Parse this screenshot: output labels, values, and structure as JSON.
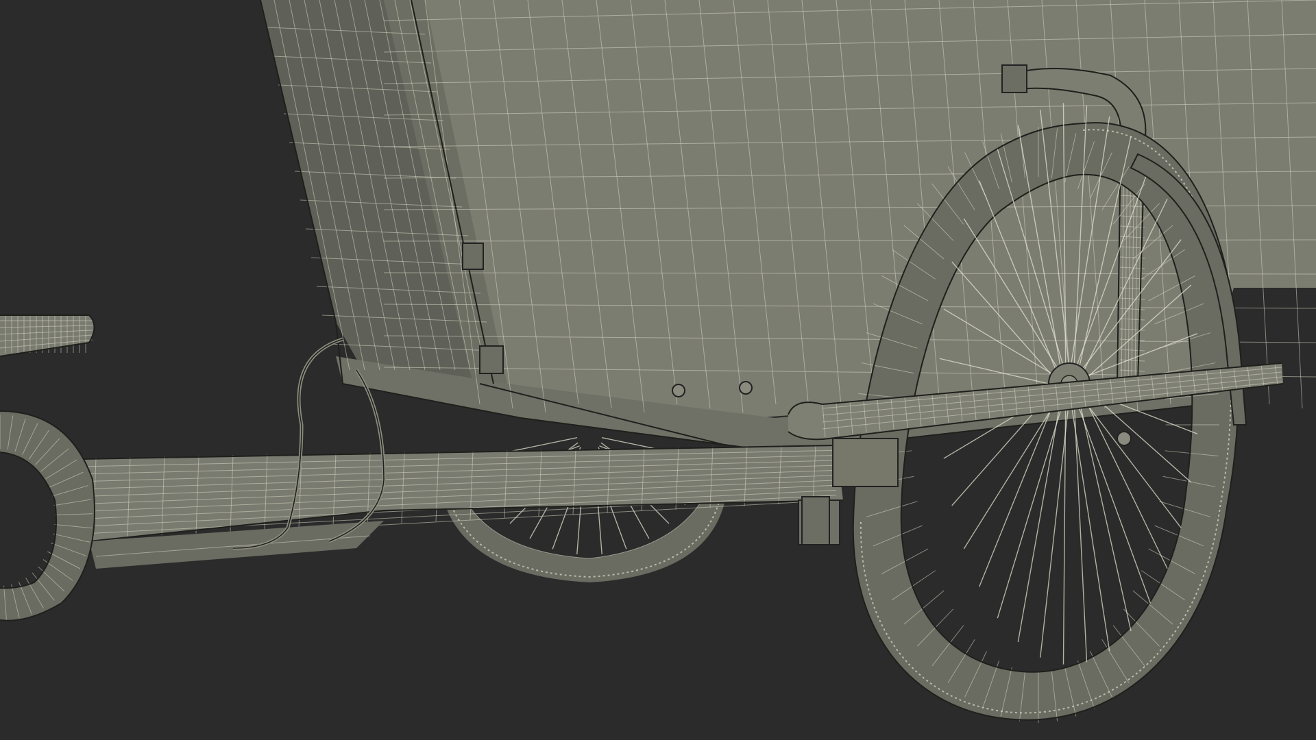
{
  "colors": {
    "background": "#2b2b2b",
    "surface": "#7c7d71",
    "surface_dark": "#5f6057",
    "wire": "#d6d6c4"
  },
  "scene": {
    "subject": "wireframe-cargo-tricycle"
  }
}
